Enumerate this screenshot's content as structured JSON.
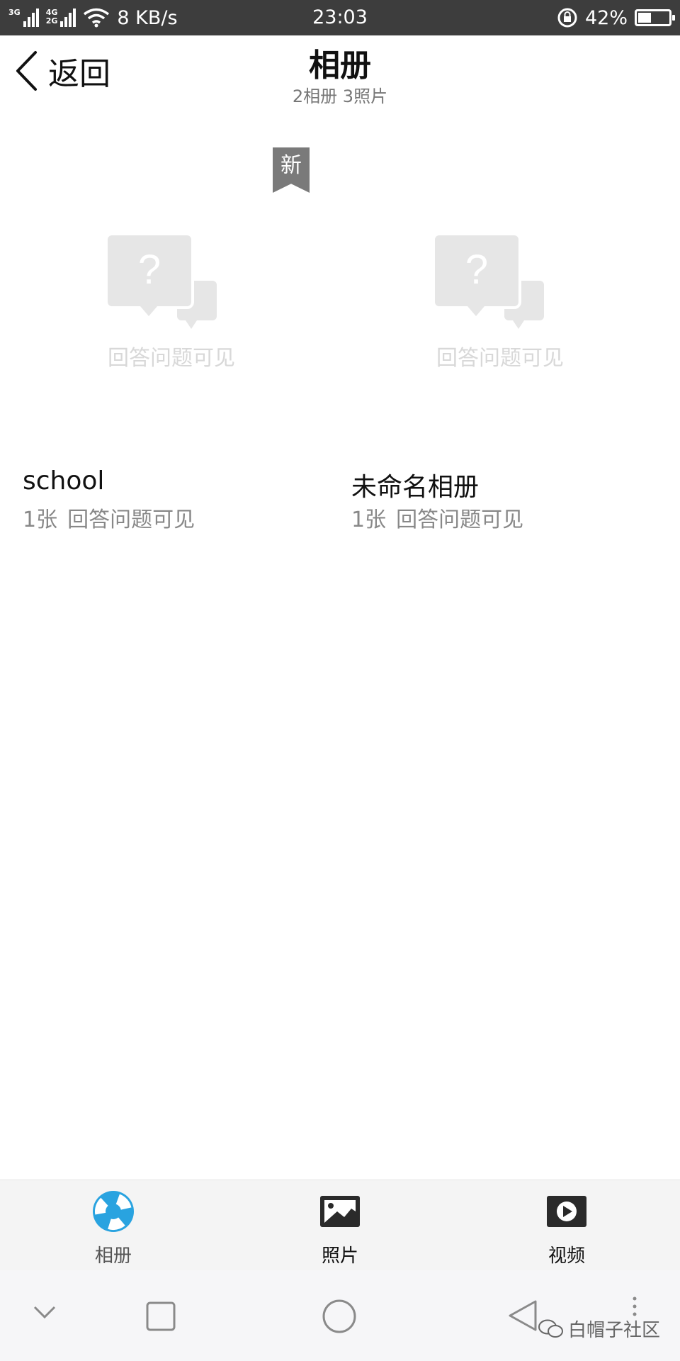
{
  "status_bar": {
    "signal1_tag": "3G",
    "signal2_tag": "4G",
    "signal3_tag": "2G",
    "net_speed": "8 KB/s",
    "time": "23:03",
    "battery": "42%"
  },
  "header": {
    "back_label": "返回",
    "title": "相册",
    "subtitle": "2相册  3照片"
  },
  "albums": [
    {
      "name": "school",
      "count": "1张",
      "note": "回答问题可见",
      "placeholder_text": "回答问题可见",
      "badge": "新"
    },
    {
      "name": "未命名相册",
      "count": "1张",
      "note": "回答问题可见",
      "placeholder_text": "回答问题可见"
    }
  ],
  "tabs": [
    {
      "label": "相册",
      "icon": "albums-icon",
      "active": true
    },
    {
      "label": "照片",
      "icon": "photo-icon"
    },
    {
      "label": "视频",
      "icon": "video-icon"
    }
  ],
  "colors": {
    "status_bar": "#3d3d3d",
    "accent": "#29a3e0",
    "badge": "#7a7a7a",
    "placeholder": "#e6e6e6"
  },
  "watermark": "白帽子社区"
}
